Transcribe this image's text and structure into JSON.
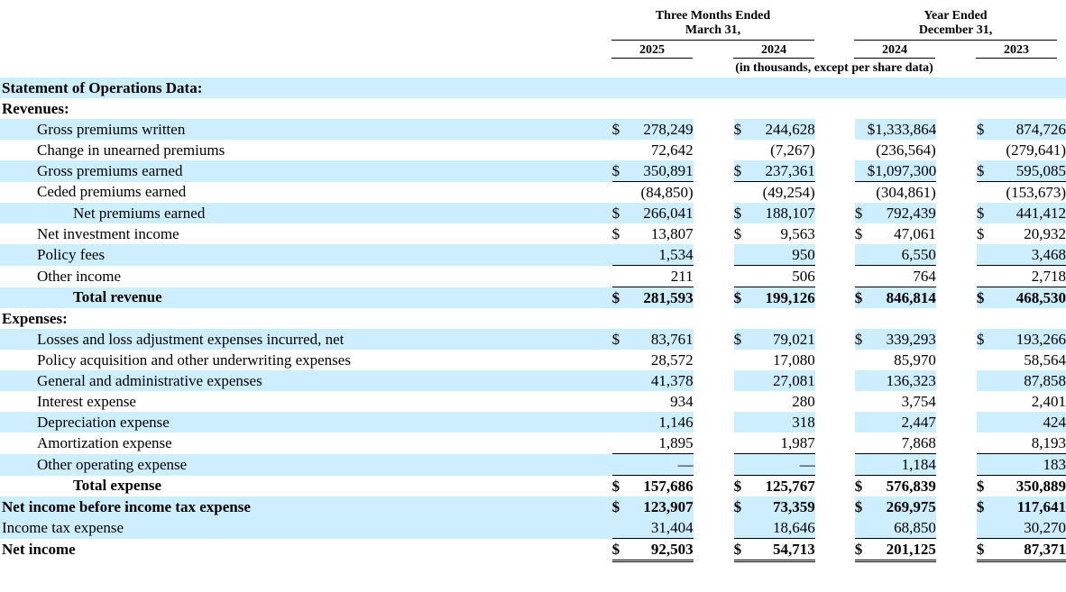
{
  "headers": {
    "three_months_line1": "Three Months Ended",
    "three_months_line2": "March 31,",
    "year_line1": "Year Ended",
    "year_line2": "December 31,",
    "col_2025": "2025",
    "col_2024a": "2024",
    "col_2024b": "2024",
    "col_2023": "2023",
    "units_note": "(in thousands, except per share data)"
  },
  "rows": [
    {
      "label": "Statement of Operations Data:",
      "type": "section"
    },
    {
      "label": "Revenues:",
      "type": "section"
    },
    {
      "label": "Gross premiums written",
      "d": [
        "$",
        "$",
        "",
        "$"
      ],
      "v": [
        "278,249",
        "244,628",
        "$1,333,864",
        "874,726"
      ]
    },
    {
      "label": "Change in unearned premiums",
      "d": [
        "",
        "",
        "",
        ""
      ],
      "v": [
        "72,642",
        "(7,267)",
        "(236,564)",
        "(279,641)"
      ]
    },
    {
      "label": "Gross premiums earned",
      "d": [
        "$",
        "$",
        "",
        "$"
      ],
      "v": [
        "350,891",
        "237,361",
        "$1,097,300",
        "595,085"
      ]
    },
    {
      "label": "Ceded premiums earned",
      "d": [
        "",
        "",
        "",
        ""
      ],
      "v": [
        "(84,850)",
        "(49,254)",
        "(304,861)",
        "(153,673)"
      ]
    },
    {
      "label": "Net premiums earned",
      "d": [
        "$",
        "$",
        "$",
        "$"
      ],
      "v": [
        "266,041",
        "188,107",
        "792,439",
        "441,412"
      ]
    },
    {
      "label": "Net investment income",
      "d": [
        "$",
        "$",
        "$",
        "$"
      ],
      "v": [
        "13,807",
        "9,563",
        "47,061",
        "20,932"
      ]
    },
    {
      "label": "Policy fees",
      "d": [
        "",
        "",
        "",
        ""
      ],
      "v": [
        "1,534",
        "950",
        "6,550",
        "3,468"
      ]
    },
    {
      "label": "Other income",
      "d": [
        "",
        "",
        "",
        ""
      ],
      "v": [
        "211",
        "506",
        "764",
        "2,718"
      ]
    },
    {
      "label": "Total revenue",
      "d": [
        "$",
        "$",
        "$",
        "$"
      ],
      "v": [
        "281,593",
        "199,126",
        "846,814",
        "468,530"
      ]
    },
    {
      "label": "Expenses:",
      "type": "section"
    },
    {
      "label": "Losses and loss adjustment expenses incurred, net",
      "d": [
        "$",
        "$",
        "$",
        "$"
      ],
      "v": [
        "83,761",
        "79,021",
        "339,293",
        "193,266"
      ]
    },
    {
      "label": "Policy acquisition and other underwriting expenses",
      "d": [
        "",
        "",
        "",
        ""
      ],
      "v": [
        "28,572",
        "17,080",
        "85,970",
        "58,564"
      ]
    },
    {
      "label": "General and administrative expenses",
      "d": [
        "",
        "",
        "",
        ""
      ],
      "v": [
        "41,378",
        "27,081",
        "136,323",
        "87,858"
      ]
    },
    {
      "label": "Interest expense",
      "d": [
        "",
        "",
        "",
        ""
      ],
      "v": [
        "934",
        "280",
        "3,754",
        "2,401"
      ]
    },
    {
      "label": "Depreciation expense",
      "d": [
        "",
        "",
        "",
        ""
      ],
      "v": [
        "1,146",
        "318",
        "2,447",
        "424"
      ]
    },
    {
      "label": "Amortization expense",
      "d": [
        "",
        "",
        "",
        ""
      ],
      "v": [
        "1,895",
        "1,987",
        "7,868",
        "8,193"
      ]
    },
    {
      "label": "Other operating expense",
      "d": [
        "",
        "",
        "",
        ""
      ],
      "v": [
        "—",
        "—",
        "1,184",
        "183"
      ]
    },
    {
      "label": "Total expense",
      "d": [
        "$",
        "$",
        "$",
        "$"
      ],
      "v": [
        "157,686",
        "125,767",
        "576,839",
        "350,889"
      ]
    },
    {
      "label": "Net income before income tax expense",
      "d": [
        "$",
        "$",
        "$",
        "$"
      ],
      "v": [
        "123,907",
        "73,359",
        "269,975",
        "117,641"
      ]
    },
    {
      "label": "Income tax expense",
      "d": [
        "",
        "",
        "",
        ""
      ],
      "v": [
        "31,404",
        "18,646",
        "68,850",
        "30,270"
      ]
    },
    {
      "label": "Net income",
      "d": [
        "$",
        "$",
        "$",
        "$"
      ],
      "v": [
        "92,503",
        "54,713",
        "201,125",
        "87,371"
      ]
    }
  ]
}
